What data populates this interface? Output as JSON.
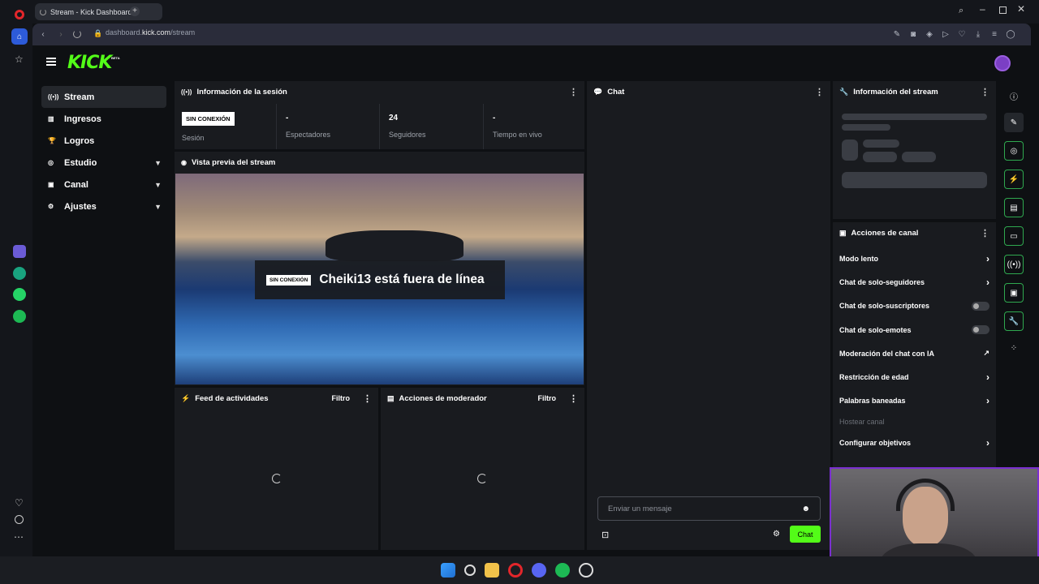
{
  "browser": {
    "tab_title": "Stream - Kick Dashboard",
    "url_prefix": "dashboard.",
    "url_domain": "kick.com",
    "url_path": "/stream"
  },
  "header": {
    "logo_text": "KICK",
    "logo_badge": "BETA"
  },
  "sidebar": {
    "items": [
      {
        "label": "Stream",
        "icon": "broadcast-icon"
      },
      {
        "label": "Ingresos",
        "icon": "chart-icon"
      },
      {
        "label": "Logros",
        "icon": "trophy-icon"
      },
      {
        "label": "Estudio",
        "icon": "studio-icon"
      },
      {
        "label": "Canal",
        "icon": "channel-icon"
      },
      {
        "label": "Ajustes",
        "icon": "gear-icon"
      }
    ]
  },
  "session": {
    "title": "Información de la sesión",
    "status_badge": "SIN CONEXIÓN",
    "status_label": "Sesión",
    "viewers_value": "-",
    "viewers_label": "Espectadores",
    "followers_value": "24",
    "followers_label": "Seguidores",
    "live_time_value": "-",
    "live_time_label": "Tiempo en vivo"
  },
  "preview": {
    "title": "Vista previa del stream",
    "offline_badge": "SIN CONEXIÓN",
    "offline_text": "Cheiki13 está fuera de línea"
  },
  "activity": {
    "title": "Feed de actividades",
    "filter": "Filtro"
  },
  "mod_actions": {
    "title": "Acciones de moderador",
    "filter": "Filtro"
  },
  "chat": {
    "title": "Chat",
    "input_placeholder": "Enviar un mensaje",
    "send_button": "Chat"
  },
  "stream_info": {
    "title": "Información del stream"
  },
  "channel_actions": {
    "title": "Acciones de canal",
    "items": [
      {
        "label": "Modo lento",
        "control": "arrow"
      },
      {
        "label": "Chat de solo-seguidores",
        "control": "arrow"
      },
      {
        "label": "Chat de solo-suscriptores",
        "control": "toggle"
      },
      {
        "label": "Chat de solo-emotes",
        "control": "toggle"
      },
      {
        "label": "Moderación del chat con IA",
        "control": "external"
      },
      {
        "label": "Restricción de edad",
        "control": "arrow"
      },
      {
        "label": "Palabras baneadas",
        "control": "arrow"
      },
      {
        "label": "Hostear canal",
        "control": "disabled"
      },
      {
        "label": "Configurar objetivos",
        "control": "arrow"
      }
    ]
  },
  "colors": {
    "brand": "#53fc18",
    "panel": "#191b1f",
    "background": "#0e1013",
    "accent_border": "#2fa84f"
  }
}
